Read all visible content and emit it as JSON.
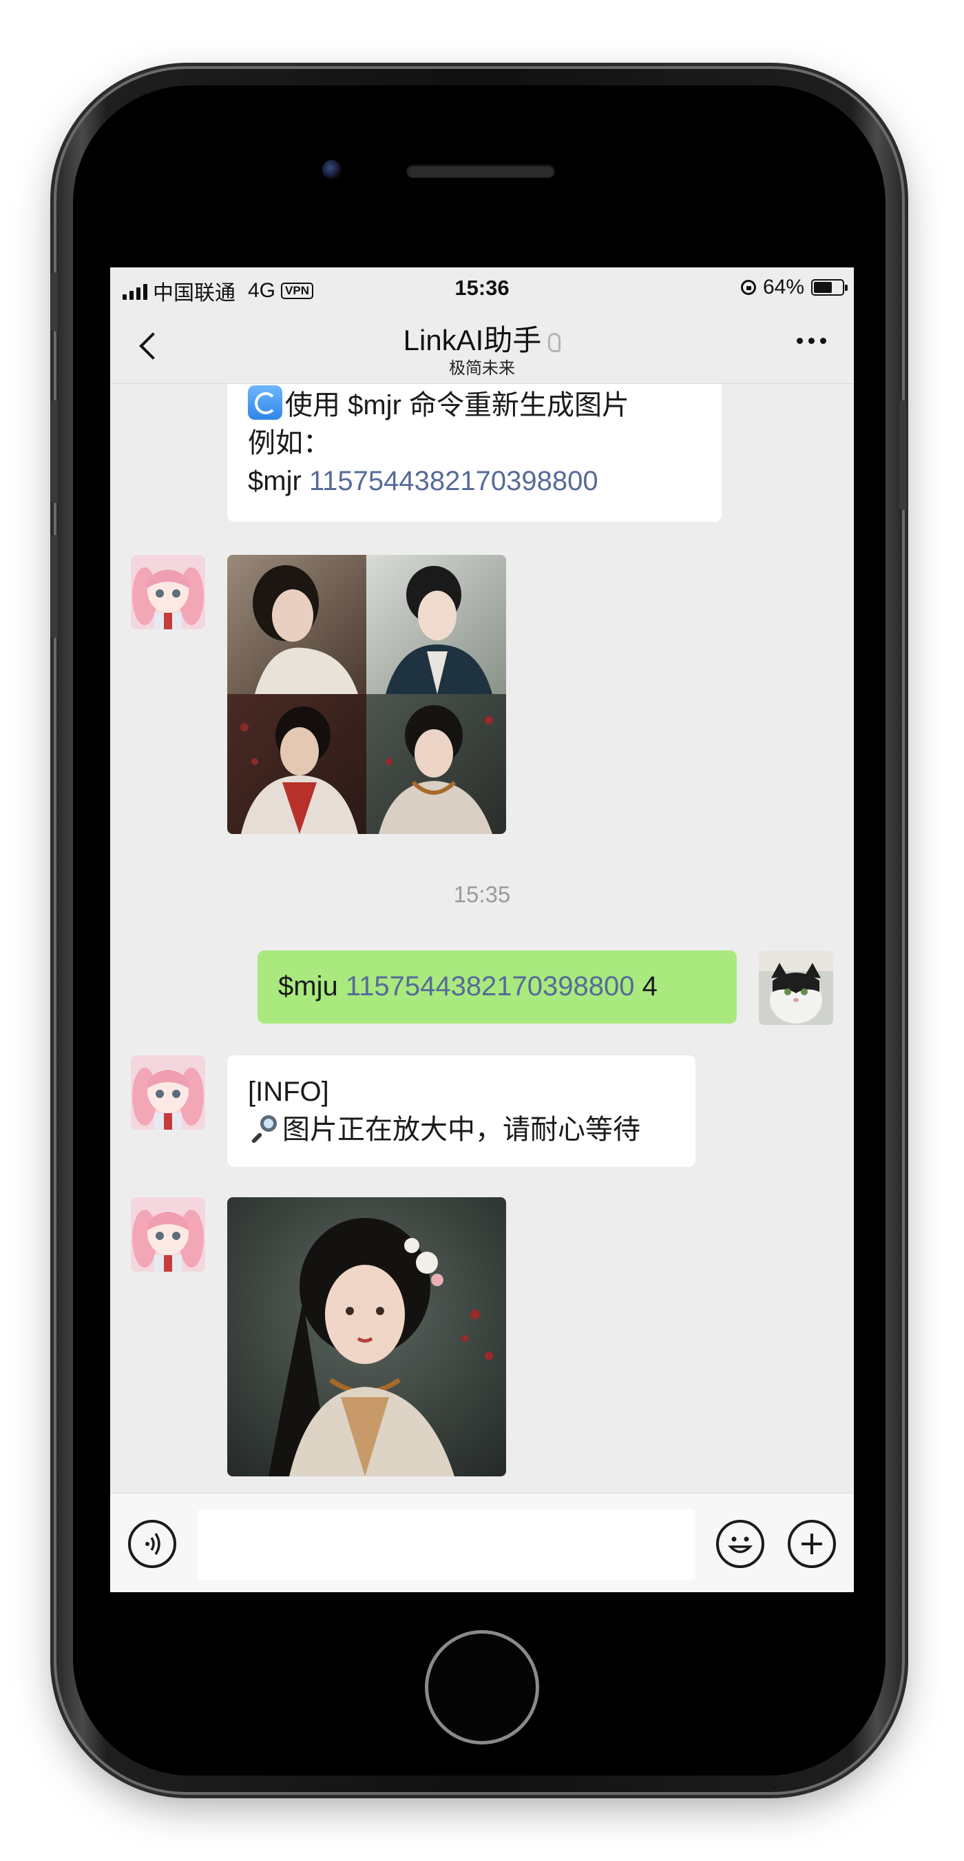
{
  "status_bar": {
    "carrier": "中国联通",
    "network": "4G",
    "vpn": "VPN",
    "time": "15:36",
    "battery": "64%",
    "battery_level": 0.64
  },
  "header": {
    "title": "LinkAI助手",
    "subtitle": "极简未来"
  },
  "messages": {
    "m1": {
      "line1": "使用 $mjr 命令重新生成图片",
      "line2": "例如：",
      "line3_prefix": "$mjr ",
      "line3_link": "1157544382170398800"
    },
    "time_divider": "15:35",
    "m2": {
      "prefix": "$mju ",
      "link": "1157544382170398800",
      "suffix": " 4"
    },
    "m3": {
      "line1": "[INFO]",
      "line2": "图片正在放大中，请耐心等待"
    }
  },
  "icons": {
    "back": "chevron-left-icon",
    "more": "ellipsis-icon",
    "voice": "voice-icon",
    "emoji": "emoji-icon",
    "add": "plus-icon"
  },
  "colors": {
    "chat_bg": "#ededed",
    "outgoing_bubble": "#a9e97e",
    "link": "#566b98"
  }
}
